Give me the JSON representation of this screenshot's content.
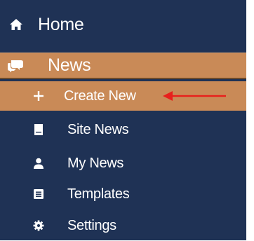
{
  "menu": {
    "home": {
      "label": "Home",
      "icon": "home-icon"
    },
    "news": {
      "label": "News",
      "icon": "chat-bubbles-icon"
    },
    "items": [
      {
        "label": "Create New",
        "icon": "plus-icon"
      },
      {
        "label": "Site News",
        "icon": "document-icon"
      },
      {
        "label": "My News",
        "icon": "user-icon"
      },
      {
        "label": "Templates",
        "icon": "list-icon"
      },
      {
        "label": "Settings",
        "icon": "gear-icon"
      }
    ]
  },
  "colors": {
    "sidebar_bg": "#1f3255",
    "active_bg": "#c98a57",
    "text": "#ffffff",
    "arrow": "#e8201c"
  }
}
